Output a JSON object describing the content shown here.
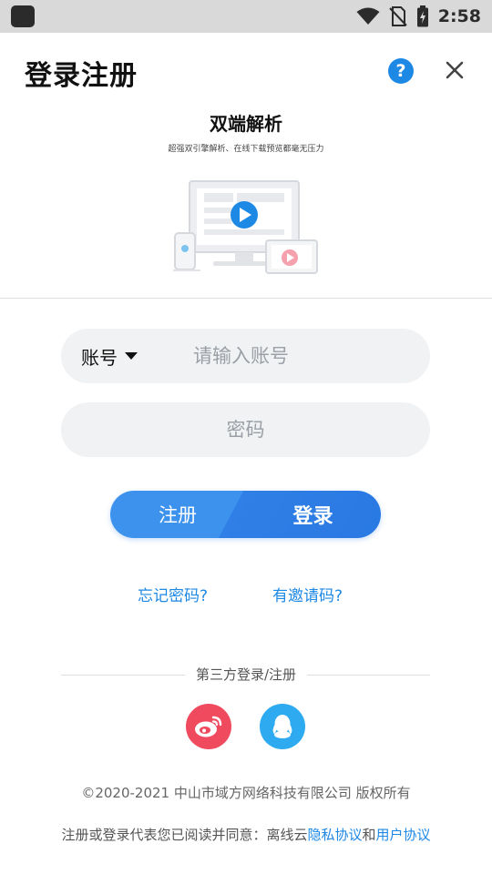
{
  "status_bar": {
    "time": "2:58",
    "icons": [
      "app-icon",
      "wifi-icon",
      "no-sim-icon",
      "battery-charging-icon"
    ]
  },
  "header": {
    "title": "登录注册",
    "help_label": "?",
    "close_icon": "close-icon"
  },
  "banner": {
    "title": "双端解析",
    "subtitle": "超强双引擎解析、在线下载预览都毫无压力"
  },
  "form": {
    "account_type_label": "账号",
    "account_placeholder": "请输入账号",
    "account_value": "",
    "password_placeholder": "密码",
    "password_value": ""
  },
  "auth_toggle": {
    "register_label": "注册",
    "login_label": "登录",
    "selected": "登录"
  },
  "links": {
    "forgot_password": "忘记密码?",
    "invite_code": "有邀请码?"
  },
  "third_party": {
    "label": "第三方登录/注册",
    "providers": [
      "weibo-icon",
      "qq-icon"
    ]
  },
  "footer": {
    "copyright": "©2020-2021 中山市域方网络科技有限公司 版权所有",
    "agreement_prefix": "注册或登录代表您已阅读并同意：离线云",
    "privacy_link": "隐私协议",
    "agreement_and": "和",
    "user_link": "用户协议"
  },
  "colors": {
    "accent": "#1e88e5",
    "button_blue": "#2f7fe6",
    "weibo_red": "#f04a5e",
    "qq_blue": "#2eaaf0",
    "field_bg": "#f1f2f4"
  }
}
